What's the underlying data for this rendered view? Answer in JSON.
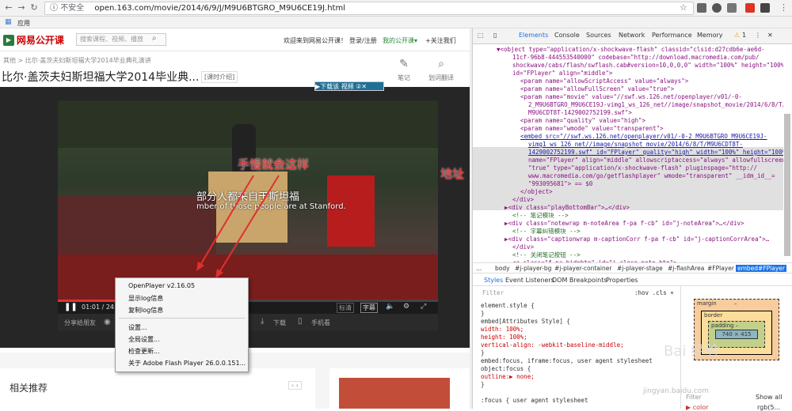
{
  "browser": {
    "security_label": "不安全",
    "url": "open.163.com/movie/2014/6/9/J/M9U6BTGRO_M9U6CE19J.html",
    "bookmarks_label": "应用"
  },
  "site": {
    "logo_text": "网易公开课",
    "search_placeholder": "搜索课程、视频、播放",
    "top_links": [
      "欢迎来到网易公开课！",
      "登录/注册",
      "我的公开课▾",
      "+关注我们"
    ],
    "breadcrumb": "其他 > 比尔·盖茨夫妇斯坦福大学2014毕业典礼演讲",
    "title": "比尔·盖茨夫妇斯坦福大学2014毕业典...",
    "kind_badge": "[课时介绍]",
    "tools": [
      "笔记",
      "划词翻译"
    ],
    "download_bar": "▶下载该 视频 ②✕"
  },
  "player": {
    "subtitle_cn": "部分人都来自于斯坦福",
    "subtitle_en": "mber of those people are at Stanford.",
    "time": "01:01 / 24:4",
    "buttons": [
      "标清",
      "字幕"
    ],
    "share_label": "分享给朋友",
    "download": "下载",
    "mobile": "手机看"
  },
  "context_menu": {
    "items": [
      "OpenPlayer v2.16.05",
      "显示log信息",
      "复制log信息",
      "设置...",
      "全局设置...",
      "检查更新...",
      "关于 Adobe Flash Player 26.0.0.151..."
    ]
  },
  "related": {
    "title": "相关推荐"
  },
  "annotations": {
    "manual": "手慢就会这样",
    "address": "地址"
  },
  "devtools": {
    "tabs": [
      "Elements",
      "Console",
      "Sources",
      "Network",
      "Performance",
      "Memory"
    ],
    "warn_count": "1",
    "dom_lines": [
      "▼<object type=\"application/x-shockwave-flash\" classid=\"clsid:d27cdb6e-ae6d-",
      "11cf-96b8-444553540000\" codebase=\"http://download.macromedia.com/pub/",
      "shockwave/cabs/flash/swflash.cab#version=10,0,0,0\" width=\"100%\" height=\"100%\"",
      "id=\"FPlayer\" align=\"middle\">",
      "<param name=\"allowScriptAccess\" value=\"always\">",
      "<param name=\"allowFullScreen\" value=\"true\">",
      "<param name=\"movie\" value=\"//swf.ws.126.net/openplayer/v01/-0-",
      "2_M9U6BTGRO_M9U6CE19J-vimg1_ws_126_net//image/snapshot_movie/2014/6/8/T/",
      "M9U6CDT8T-1429002752199.swf\">",
      "<param name=\"quality\" value=\"high\">",
      "<param name=\"wmode\" value=\"transparent\">",
      "<embed src=\"//swf.ws.126.net/openplayer/v01/-0-2_M9U6BTGRO_M9U6CE19J-",
      "vimg1_ws_126_net//image/snapshot_movie/2014/6/8/T/M9U6CDT8T-",
      "1429002752199.swf\" id=\"FPlayer\" quality=\"high\" width=\"100%\" height=\"100%\"",
      "name=\"FPlayer\" align=\"middle\" allowscriptaccess=\"always\" allowfullscreen=",
      "\"true\" type=\"application/x-shockwave-flash\" pluginspage=\"http://",
      "www.macromedia.com/go/getflashplayer\" wmode=\"transparent\" __idm_id__=",
      "\"993095681\"> == $0",
      "</object>",
      "</div>",
      "▶<div class=\"playBottomBar\">…</div>",
      "<!-- 笔记模块 -->",
      "▶<div class=\"notewrap m-noteArea f-pa f-cb\" id=\"j-noteArea\">…</div>",
      "<!-- 字幕纠错模块 -->",
      "▶<div class=\"captionwrap m-captionCorr f-pa f-cb\" id=\"j-captionCorrArea\">…",
      "</div>",
      "<!-- 关闭笔记按钮 -->",
      "<a class=\"f-pa hidebtn\" id=\"j-close-note-btn\">"
    ],
    "crumbs": [
      "...",
      "body",
      "#j-player-bg",
      "#j-player-container",
      "#j-player-stage",
      "#j-flashArea",
      "#FPlayer",
      "embed#FPlayer"
    ],
    "style_tabs": [
      "Styles",
      "Event Listeners",
      "DOM Breakpoints",
      "Properties"
    ],
    "filter_placeholder": "Filter",
    "hov_cls": ":hov  .cls  +",
    "style_lines": [
      "element.style {",
      "}",
      "embed[Attributes Style] {",
      "  width: 100%;",
      "  height: 100%;",
      "  vertical-align: -webkit-baseline-middle;",
      "}",
      "embed:focus, iframe:focus,      user agent stylesheet",
      "object:focus {",
      "  outline:▶ none;",
      "}",
      "",
      ":focus {                        user agent stylesheet"
    ],
    "box": {
      "margin": "margin",
      "border": "border",
      "padding": "padding –",
      "content": "740 × 415",
      "dash": "–"
    },
    "filter2": "Filter",
    "show_all": "Show all",
    "color_row": "▶ color",
    "color_val": "rgb(5..."
  },
  "watermark": {
    "text": "Bai 经验",
    "url": "jingyan.baidu.com"
  }
}
